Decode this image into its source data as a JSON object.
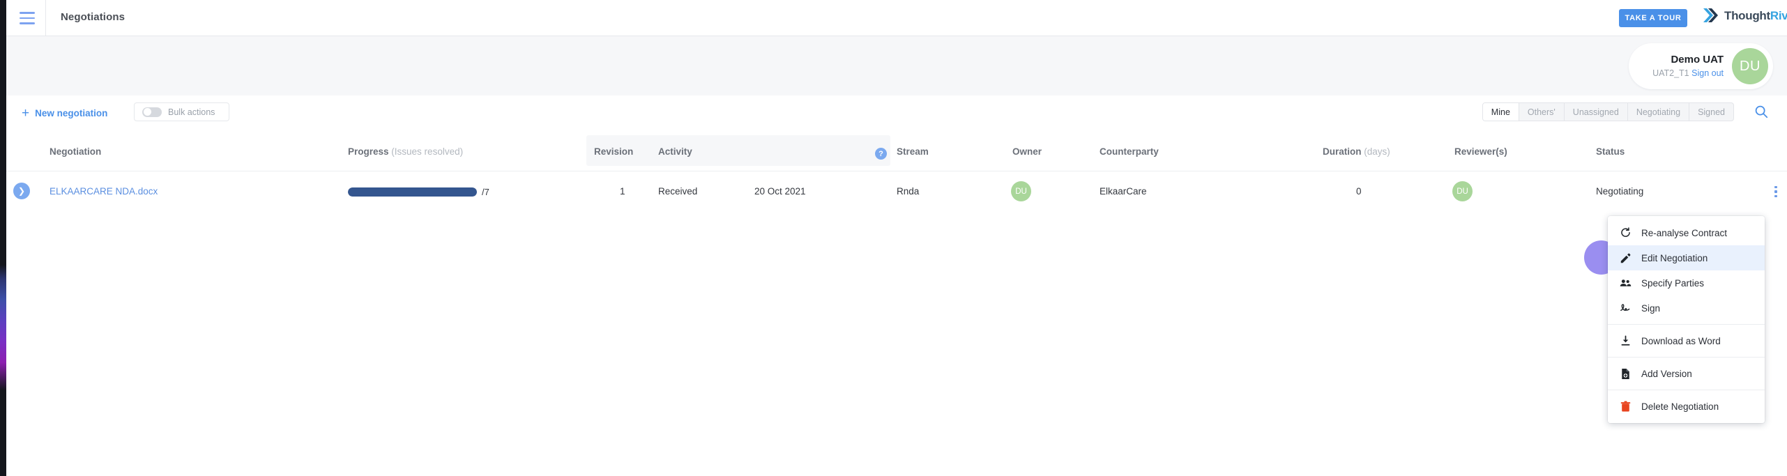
{
  "topbar": {
    "menu_icon": "hamburger-icon",
    "title": "Negotiations",
    "tour_button": "TAKE A TOUR",
    "logo_part1": "Thought",
    "logo_part2": "River",
    "logo_tm": "™"
  },
  "account": {
    "name": "Demo UAT",
    "tenant": "UAT2_T1",
    "signout": "Sign out",
    "initials": "DU"
  },
  "toolbar": {
    "new_negotiation": "New negotiation",
    "plus_icon": "plus-icon",
    "bulk_actions": "Bulk actions",
    "search_icon": "search-icon",
    "filters": [
      {
        "label": "Mine",
        "active": true
      },
      {
        "label": "Others'",
        "active": false
      },
      {
        "label": "Unassigned",
        "active": false
      },
      {
        "label": "Negotiating",
        "active": false
      },
      {
        "label": "Signed",
        "active": false
      }
    ]
  },
  "table": {
    "headers": {
      "negotiation": "Negotiation",
      "progress": "Progress",
      "progress_sub": "(Issues resolved)",
      "revision": "Revision",
      "activity": "Activity",
      "help_icon": "?",
      "stream": "Stream",
      "owner": "Owner",
      "counterparty": "Counterparty",
      "duration": "Duration",
      "duration_sub": "(days)",
      "reviewers": "Reviewer(s)",
      "status": "Status"
    },
    "rows": [
      {
        "expand_icon": "chevron-right-icon",
        "name": "ELKAARCARE NDA.docx",
        "progress_resolved": 7,
        "progress_total": 7,
        "progress_text": "/7",
        "progress_percent": 100,
        "revision": "1",
        "activity": "Received",
        "activity_date": "20 Oct 2021",
        "stream": "Rnda",
        "owner_initials": "DU",
        "counterparty": "ElkaarCare",
        "duration": "0",
        "reviewer_initials": "DU",
        "status": "Negotiating"
      }
    ]
  },
  "context_menu": {
    "items": [
      {
        "label": "Re-analyse Contract",
        "icon": "refresh-icon",
        "highlighted": false,
        "separator_after": false
      },
      {
        "label": "Edit Negotiation",
        "icon": "pencil-icon",
        "highlighted": true,
        "separator_after": false
      },
      {
        "label": "Specify Parties",
        "icon": "people-icon",
        "highlighted": false,
        "separator_after": false
      },
      {
        "label": "Sign",
        "icon": "signature-icon",
        "highlighted": false,
        "separator_after": true
      },
      {
        "label": "Download as Word",
        "icon": "download-icon",
        "highlighted": false,
        "separator_after": true
      },
      {
        "label": "Add Version",
        "icon": "add-file-icon",
        "highlighted": false,
        "separator_after": true
      },
      {
        "label": "Delete Negotiation",
        "icon": "trash-icon",
        "highlighted": false,
        "separator_after": false
      }
    ]
  },
  "widgets": {
    "chat_bubble": "chat-support-bubble"
  },
  "colors": {
    "accent_blue": "#4a90e8",
    "progress_fill": "#34568f",
    "avatar_green": "#a9d69a",
    "delete_red": "#e8441f",
    "chat_purple": "#9a8ef0",
    "highlight_blue": "#e9f1fd"
  }
}
